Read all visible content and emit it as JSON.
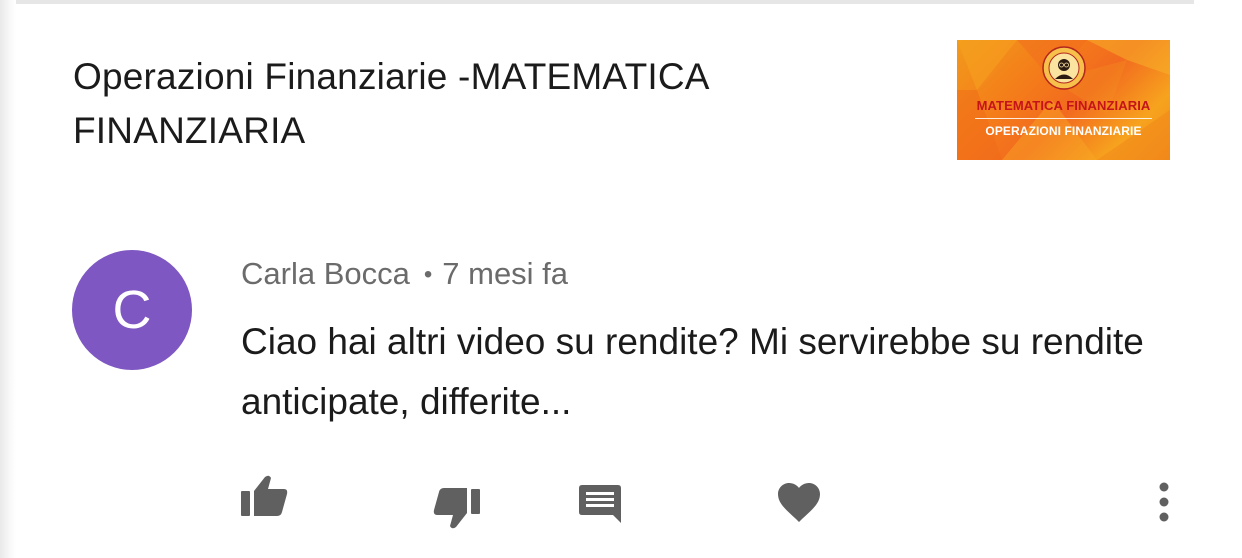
{
  "video": {
    "title": "Operazioni Finanziarie -MATEMATICA FINANZIARIA",
    "thumbnail": {
      "line1": "MATEMATICA FINANZIARIA",
      "line2": "OPERAZIONI FINANZIARIE",
      "colors": {
        "background": "#f47b1a",
        "title_text": "#c4141a",
        "subtitle_text": "#ffffff"
      }
    }
  },
  "comment": {
    "avatar": {
      "letter": "C",
      "color": "#7e57c2"
    },
    "author": "Carla Bocca",
    "separator": "•",
    "time": "7 mesi fa",
    "text": "Ciao hai altri video su rendite? Mi servirebbe su rendite anticipate, differite..."
  },
  "actions": [
    {
      "name": "like",
      "icon": "thumb-up-icon"
    },
    {
      "name": "dislike",
      "icon": "thumb-down-icon"
    },
    {
      "name": "reply",
      "icon": "comment-icon"
    },
    {
      "name": "heart",
      "icon": "heart-icon"
    },
    {
      "name": "more",
      "icon": "more-vertical-icon"
    }
  ],
  "colors": {
    "text_primary": "#1b1b1b",
    "text_secondary": "#6b6b6b",
    "icon": "#606060"
  }
}
